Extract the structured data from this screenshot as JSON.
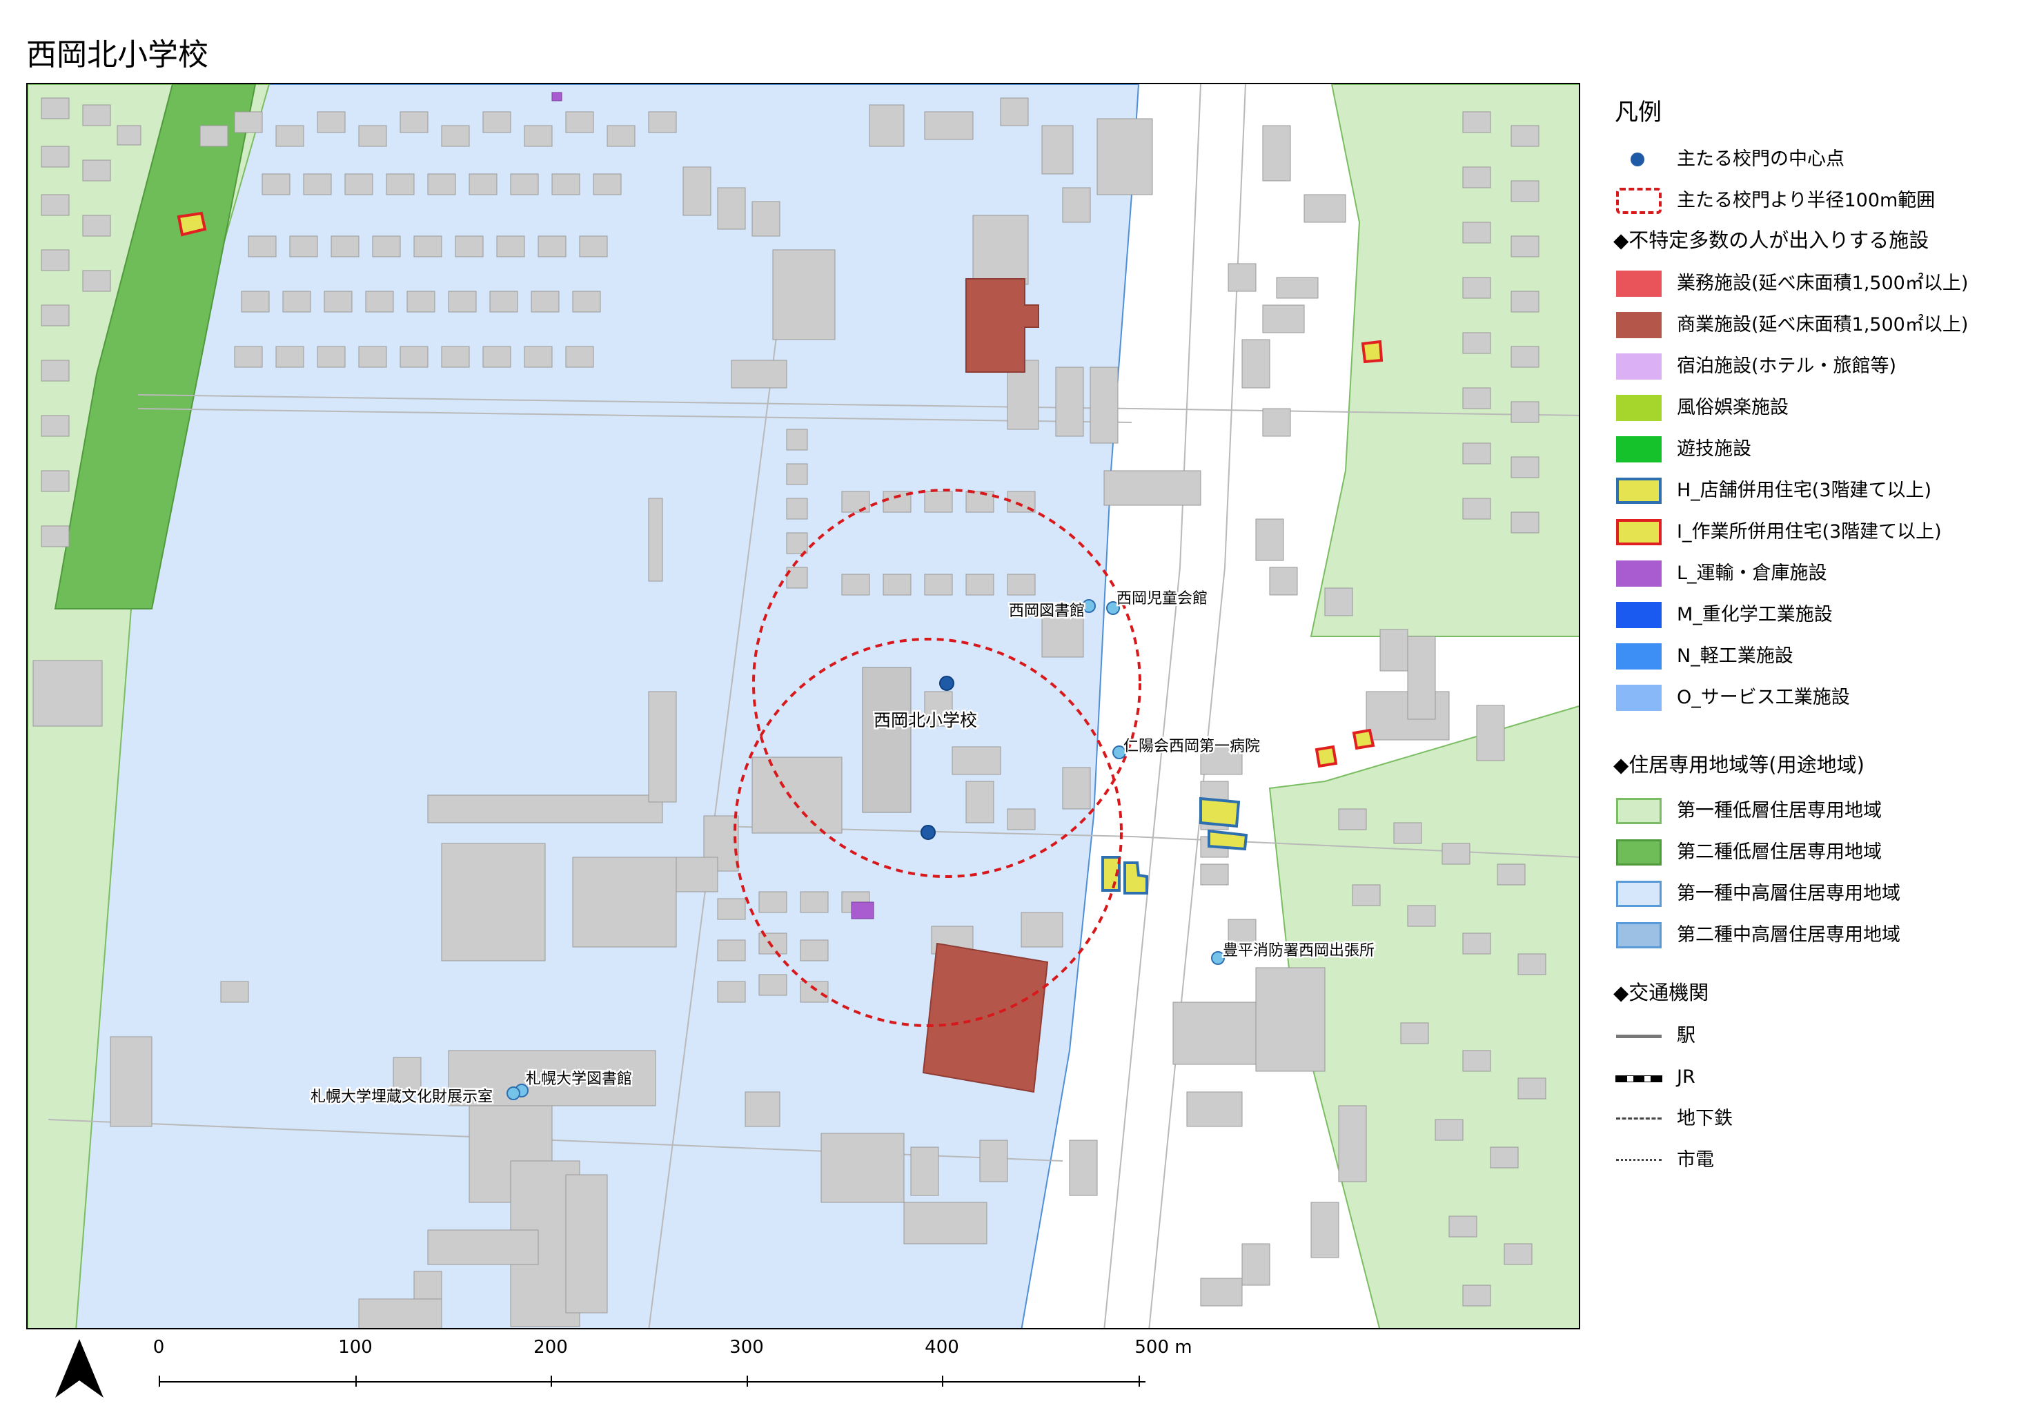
{
  "title": "西岡北小学校",
  "map": {
    "labels": {
      "school": "西岡北小学校",
      "library": "西岡図書館",
      "childrens_hall": "西岡児童会館",
      "hospital": "仁陽会西岡第一病院",
      "fire_station": "豊平消防署西岡出張所",
      "univ_library": "札幌大学図書館",
      "univ_exhibit": "札幌大学埋蔵文化財展示室"
    },
    "colors": {
      "zone_mid_high_1": "#d6e6fb",
      "zone_low_1": "#d2ecc5",
      "zone_low_2": "#6fbd58",
      "building": "#cccccc",
      "commercial": "#b5564b",
      "radius_circle": "#d7191c",
      "gate_point": "#1f5aa6",
      "facility_point": "#76c3ea",
      "shop_house_fill": "#e5e34f",
      "shop_house_border": "#2e6fb0",
      "workshop_border": "#e02020",
      "warehouse": "#a85ccf"
    }
  },
  "legend": {
    "title": "凡例",
    "items": [
      {
        "label": "主たる校門の中心点",
        "color": "#1f5aa6"
      },
      {
        "label": "主たる校門より半径100m範囲",
        "color": "#d7191c"
      }
    ],
    "section_facilities": "◆不特定多数の人が出入りする施設",
    "facilities": [
      {
        "label": "業務施設(延べ床面積1,500㎡以上)",
        "fill": "#e8545a",
        "border": "#e8545a"
      },
      {
        "label": "商業施設(延べ床面積1,500㎡以上)",
        "fill": "#b5564b",
        "border": "#b5564b"
      },
      {
        "label": "宿泊施設(ホテル・旅館等)",
        "fill": "#dbb0f5",
        "border": "#dbb0f5"
      },
      {
        "label": "風俗娯楽施設",
        "fill": "#a6d62b",
        "border": "#a6d62b"
      },
      {
        "label": "遊技施設",
        "fill": "#15c22c",
        "border": "#15c22c"
      },
      {
        "label": "H_店舗併用住宅(3階建て以上)",
        "fill": "#e5e34f",
        "border": "#2e6fb0"
      },
      {
        "label": "I_作業所併用住宅(3階建て以上)",
        "fill": "#e5e34f",
        "border": "#e02020"
      },
      {
        "label": "L_運輸・倉庫施設",
        "fill": "#a85ccf",
        "border": "#a85ccf"
      },
      {
        "label": "M_重化学工業施設",
        "fill": "#1a5af0",
        "border": "#1a5af0"
      },
      {
        "label": "N_軽工業施設",
        "fill": "#3d8ff5",
        "border": "#3d8ff5"
      },
      {
        "label": "O_サービス工業施設",
        "fill": "#88b8f8",
        "border": "#88b8f8"
      }
    ],
    "section_zones": "◆住居専用地域等(用途地域)",
    "zones": [
      {
        "label": "第一種低層住居専用地域",
        "fill": "#d2ecc5",
        "border": "#7bbd62"
      },
      {
        "label": "第二種低層住居専用地域",
        "fill": "#6fbd58",
        "border": "#4f9a3c"
      },
      {
        "label": "第一種中高層住居専用地域",
        "fill": "#d6e6fb",
        "border": "#5a9ad8"
      },
      {
        "label": "第二種中高層住居専用地域",
        "fill": "#9cc0e4",
        "border": "#5a9ad8"
      }
    ],
    "section_transport": "◆交通機関",
    "transport": [
      {
        "label": "駅",
        "style": "solid"
      },
      {
        "label": "JR",
        "style": "rail"
      },
      {
        "label": "地下鉄",
        "style": "dashed"
      },
      {
        "label": "市電",
        "style": "dotted"
      }
    ]
  },
  "scale": {
    "labels": [
      "0",
      "100",
      "200",
      "300",
      "400",
      "500 m"
    ]
  }
}
